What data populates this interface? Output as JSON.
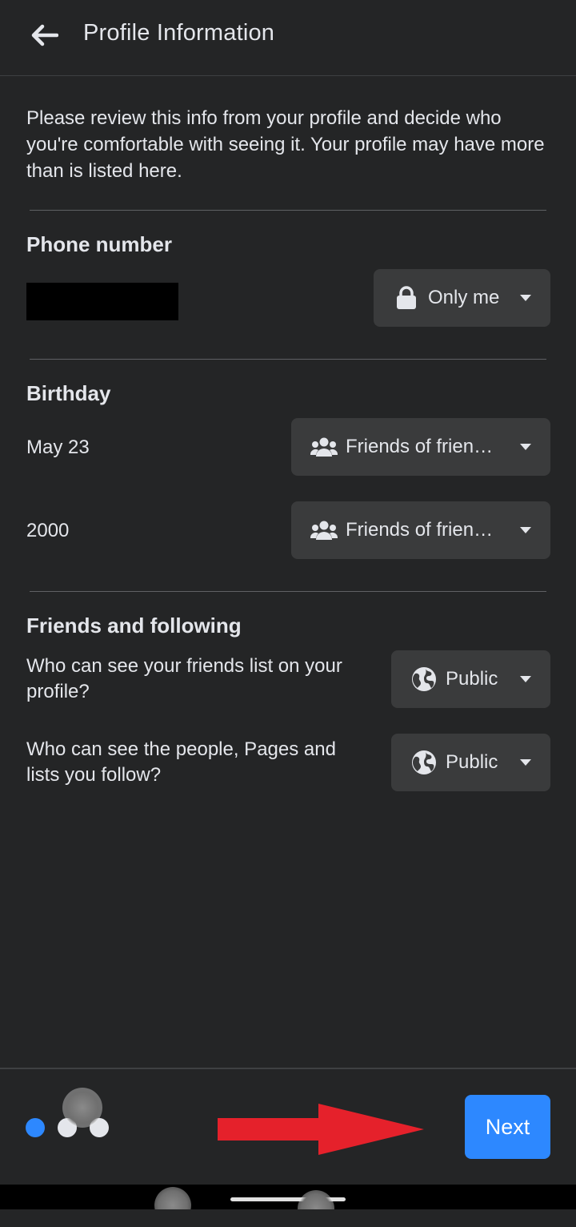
{
  "header": {
    "title": "Profile Information"
  },
  "intro": "Please review this info from your profile and decide who you're comfortable with seeing it. Your profile may have more than is listed here.",
  "phone": {
    "title": "Phone number",
    "audience": {
      "label": "Only me",
      "icon": "lock-icon"
    }
  },
  "birthday": {
    "title": "Birthday",
    "rows": [
      {
        "value": "May 23",
        "audience": {
          "label": "Friends of frien…",
          "icon": "friends-icon"
        }
      },
      {
        "value": "2000",
        "audience": {
          "label": "Friends of frien…",
          "icon": "friends-icon"
        }
      }
    ]
  },
  "friends": {
    "title": "Friends and following",
    "rows": [
      {
        "question": "Who can see your friends list on your profile?",
        "audience": {
          "label": "Public",
          "icon": "globe-icon"
        }
      },
      {
        "question": "Who can see the people, Pages and lists you follow?",
        "audience": {
          "label": "Public",
          "icon": "globe-icon"
        }
      }
    ]
  },
  "footer": {
    "next_label": "Next",
    "active_dot_color": "#2d88ff",
    "inactive_dot_color": "#e4e6eb"
  },
  "colors": {
    "background": "#242526",
    "surface": "#3a3b3c",
    "accent": "#2d88ff",
    "annotation_arrow": "#e5212b"
  }
}
